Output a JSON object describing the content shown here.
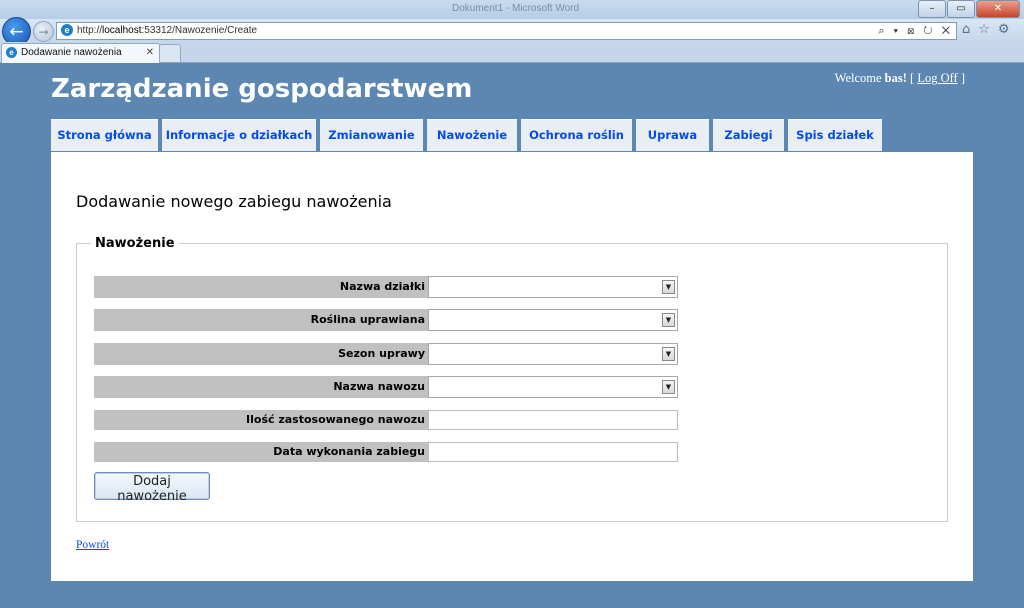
{
  "browser": {
    "window_title": "Dokument1 - Microsoft Word",
    "address_prefix": "http://",
    "address_host": "localhost",
    "address_rest": ":53312/Nawozenie/Create",
    "address_controls": "⌕ ▾ ⊠ ↻ ✕",
    "tab_label": "Dodawanie nawożenia",
    "tab_close": "✕",
    "min_label": "–",
    "max_label": "▭",
    "close_label": "✕",
    "home_icon": "⌂",
    "star_icon": "☆",
    "gear_icon": "⚙"
  },
  "site": {
    "title": "Zarządzanie gospodarstwem",
    "welcome_prefix": "Welcome",
    "username": "bas!",
    "bracket_open": "[",
    "logoff_label": "Log Off",
    "bracket_close": "]"
  },
  "menu": {
    "items": [
      {
        "label": "Strona główna"
      },
      {
        "label": "Informacje o działkach"
      },
      {
        "label": "Zmianowanie"
      },
      {
        "label": "Nawożenie"
      },
      {
        "label": "Ochrona roślin"
      },
      {
        "label": "Uprawa"
      },
      {
        "label": "Zabiegi"
      },
      {
        "label": "Spis działek"
      }
    ]
  },
  "page": {
    "heading": "Dodawanie nowego zabiegu nawożenia",
    "legend": "Nawożenie",
    "fields": [
      {
        "label": "Nazwa działki",
        "type": "select",
        "value": ""
      },
      {
        "label": "Roślina uprawiana",
        "type": "select",
        "value": ""
      },
      {
        "label": "Sezon uprawy",
        "type": "select",
        "value": ""
      },
      {
        "label": "Nazwa nawozu",
        "type": "select",
        "value": ""
      },
      {
        "label": "Ilość zastosowanego nawozu",
        "type": "text",
        "value": ""
      },
      {
        "label": "Data wykonania zabiegu",
        "type": "text",
        "value": ""
      }
    ],
    "submit_label": "Dodaj nawożenie",
    "back_label": "Powrót"
  },
  "colors": {
    "background": "#5c87b2",
    "menu_link": "#034af3",
    "label_background": "#c0c0c0"
  }
}
